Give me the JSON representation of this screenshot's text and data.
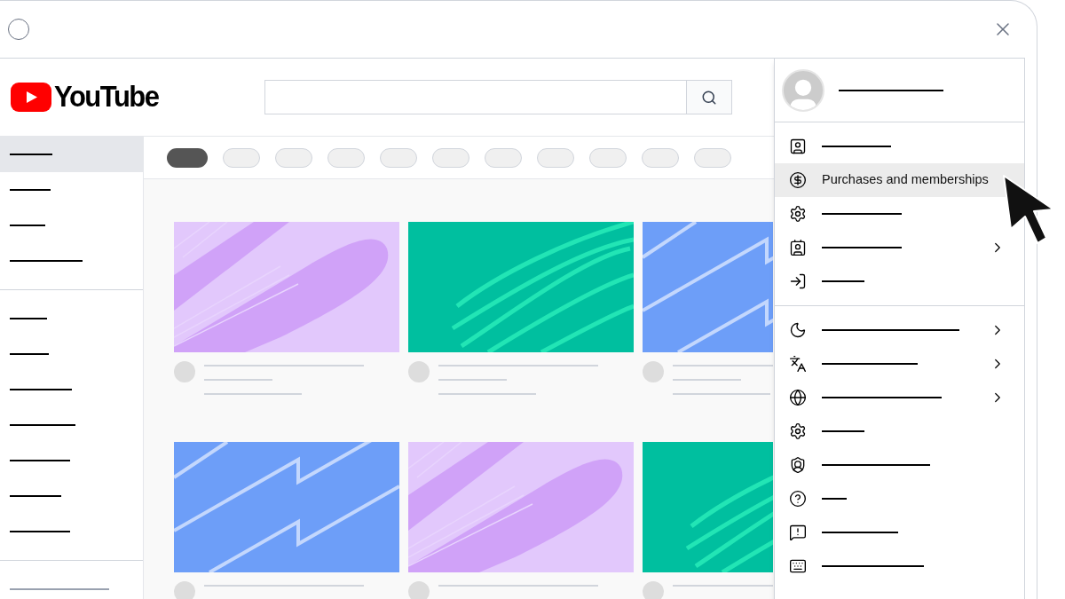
{
  "header": {
    "logo": "YouTube"
  },
  "sidebar": {
    "sections": [
      {
        "items": [
          {
            "selected": true
          },
          {
            "selected": false
          },
          {
            "selected": false
          },
          {
            "selected": false
          }
        ]
      },
      {
        "items": [
          {
            "selected": false
          },
          {
            "selected": false
          },
          {
            "selected": false
          },
          {
            "selected": false
          },
          {
            "selected": false
          },
          {
            "selected": false
          },
          {
            "selected": false
          }
        ]
      },
      {
        "items": [
          {
            "selected": false
          }
        ]
      }
    ]
  },
  "chips": [
    {
      "selected": true
    },
    {
      "selected": false
    },
    {
      "selected": false
    },
    {
      "selected": false
    },
    {
      "selected": false
    },
    {
      "selected": false
    },
    {
      "selected": false
    },
    {
      "selected": false
    },
    {
      "selected": false
    },
    {
      "selected": false
    },
    {
      "selected": false
    }
  ],
  "videos": [
    [
      {
        "kind": "purple"
      },
      {
        "kind": "green"
      },
      {
        "kind": "blue"
      }
    ],
    [
      {
        "kind": "blue"
      },
      {
        "kind": "purple"
      },
      {
        "kind": "green"
      }
    ]
  ],
  "account_menu": {
    "sections": [
      {
        "items": [
          {
            "selected": false,
            "submenu": false
          },
          {
            "label": "Purchases and memberships",
            "selected": true,
            "submenu": false
          },
          {
            "selected": false,
            "submenu": false
          },
          {
            "selected": false,
            "submenu": true
          },
          {
            "selected": false,
            "submenu": false
          }
        ]
      },
      {
        "items": [
          {
            "selected": false,
            "submenu": true
          },
          {
            "selected": false,
            "submenu": true
          },
          {
            "selected": false,
            "submenu": true
          },
          {
            "selected": false,
            "submenu": false
          },
          {
            "selected": false,
            "submenu": false
          },
          {
            "selected": false,
            "submenu": false
          },
          {
            "selected": false,
            "submenu": false
          },
          {
            "selected": false,
            "submenu": false
          }
        ]
      }
    ]
  }
}
